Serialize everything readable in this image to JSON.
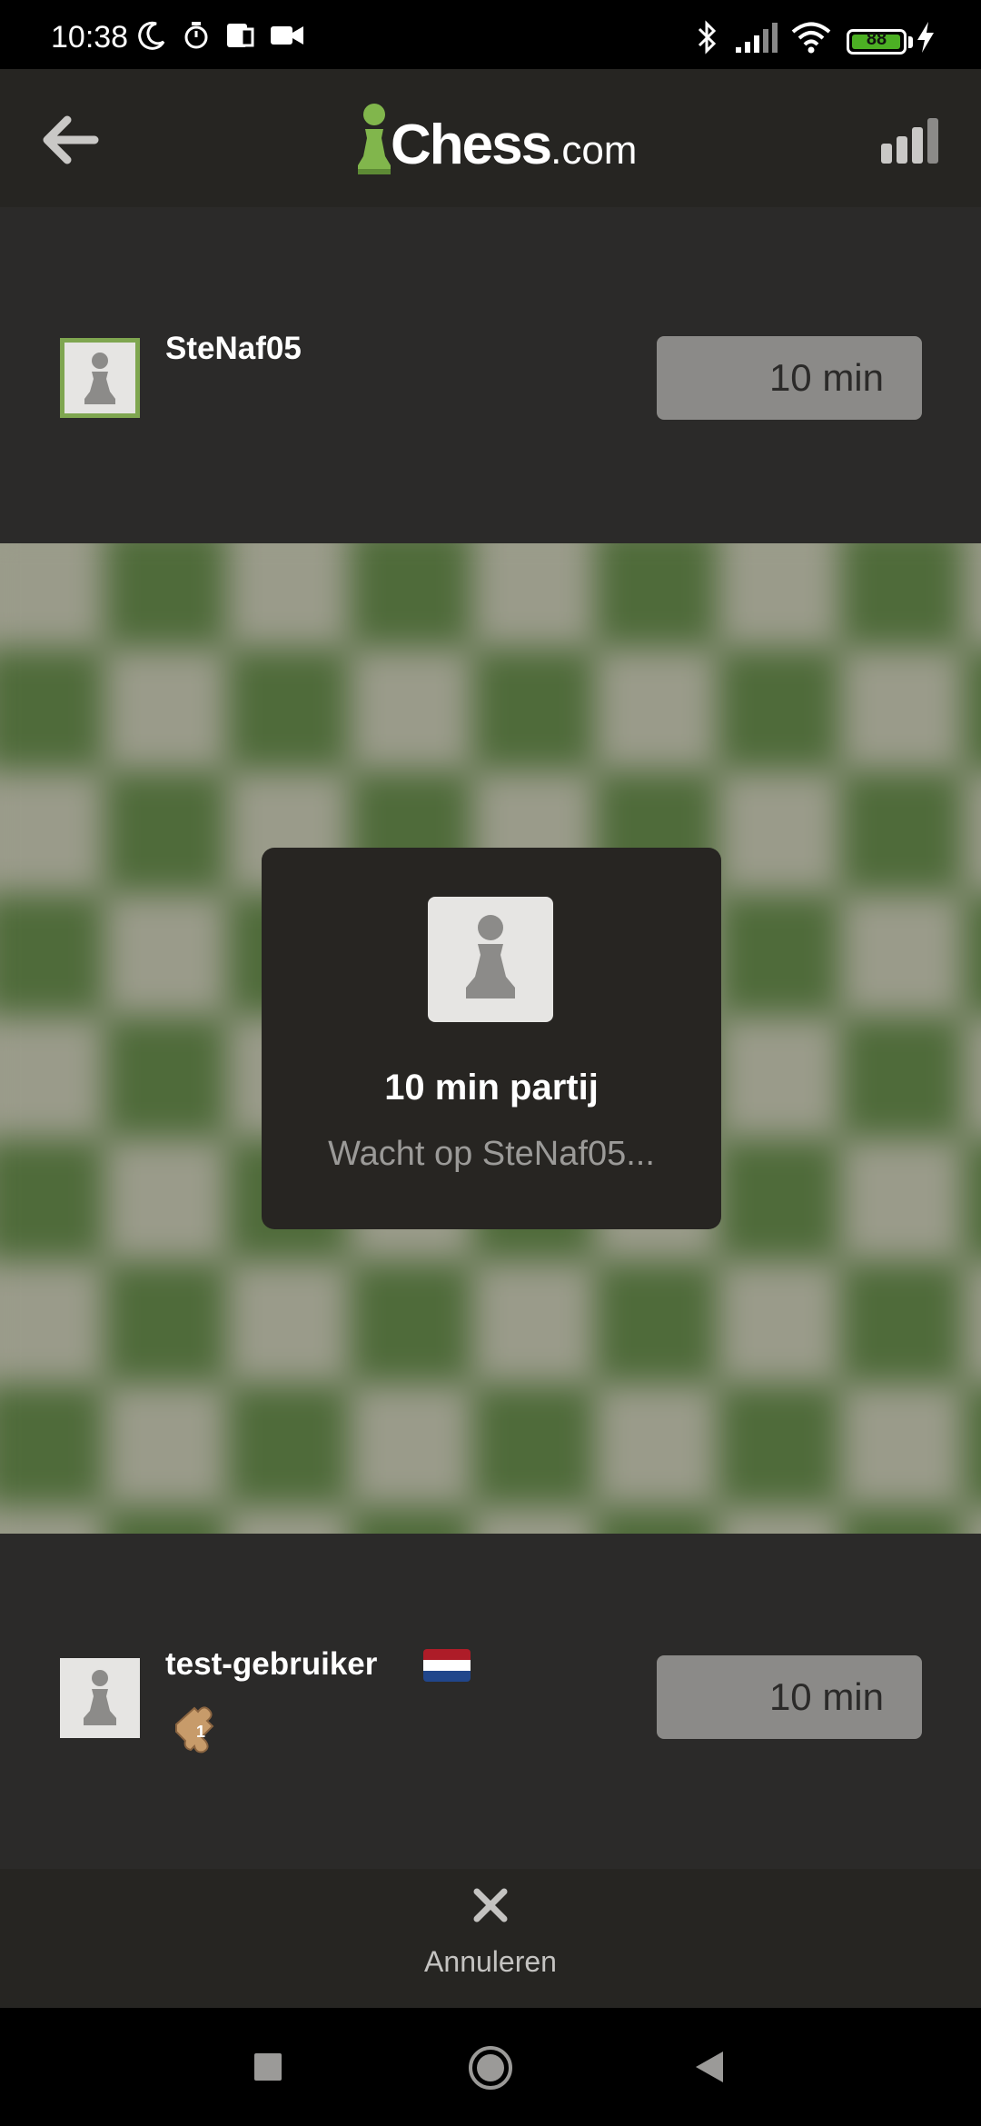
{
  "status_bar": {
    "time": "10:38",
    "battery_level": "88",
    "icons": [
      "moon-icon",
      "stopwatch-icon",
      "screen-icon",
      "video-icon",
      "bluetooth-icon",
      "signal-icon",
      "wifi-icon",
      "battery-icon",
      "charging-icon"
    ]
  },
  "header": {
    "logo_text": "Chess",
    "logo_suffix": ".com",
    "back_icon": "back-arrow-icon",
    "connection_icon": "signal-bars-icon"
  },
  "opponent": {
    "username": "SteNaf05",
    "clock": "10 min"
  },
  "dialog": {
    "title": "10 min partij",
    "subtitle": "Wacht op SteNaf05..."
  },
  "player": {
    "username": "test-gebruiker",
    "clock": "10 min",
    "flag": "netherlands-flag-icon",
    "badge": "puzzle-badge-icon",
    "badge_value": "1"
  },
  "action": {
    "cancel_label": "Annuleren"
  },
  "colors": {
    "accent_green": "#7fa650",
    "board_light": "#9a9b8a",
    "board_dark": "#4f6b3a",
    "background": "#2b2a29"
  }
}
